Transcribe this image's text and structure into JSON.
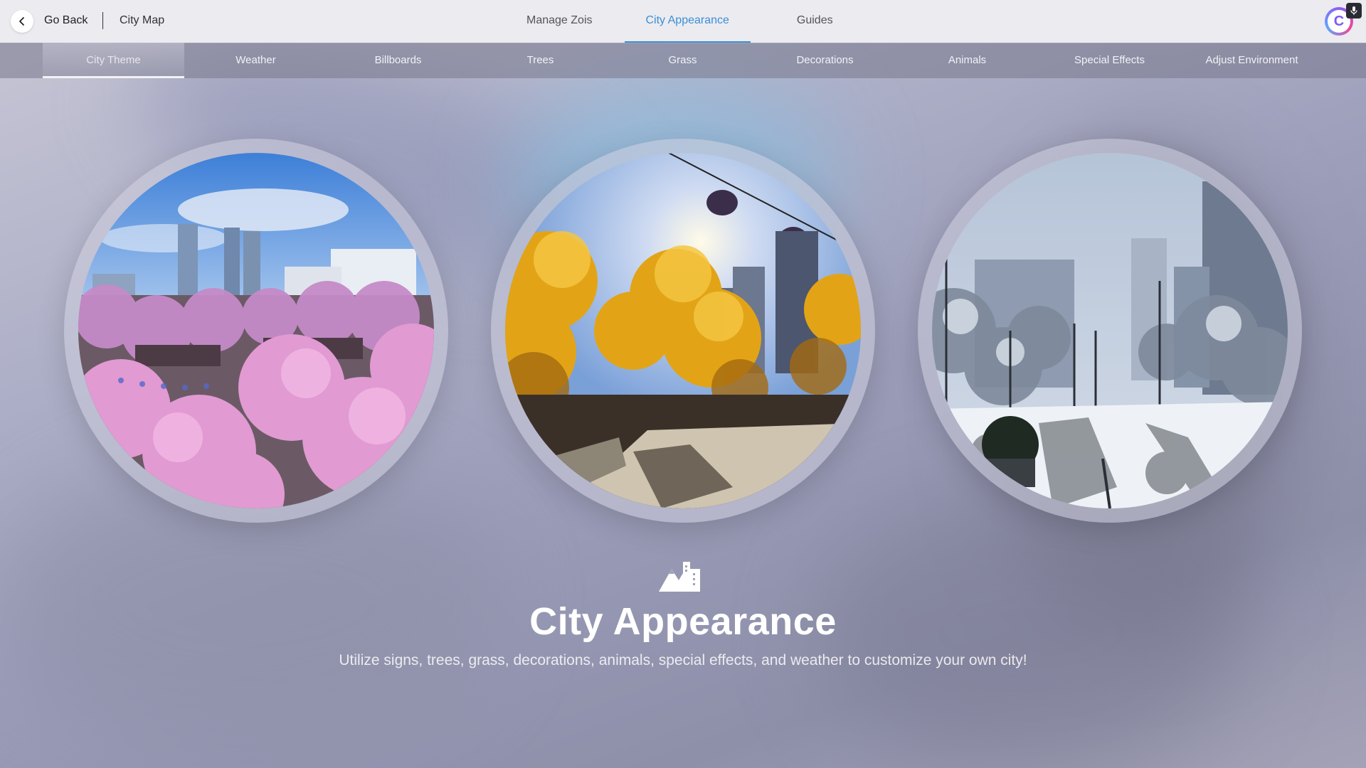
{
  "header": {
    "go_back_label": "Go Back",
    "breadcrumb": "City Map",
    "tabs": [
      {
        "label": "Manage Zois"
      },
      {
        "label": "City Appearance"
      },
      {
        "label": "Guides"
      }
    ],
    "active_tab": "City Appearance",
    "avatar_letter": "C"
  },
  "subnav": {
    "items": [
      {
        "label": "City Theme"
      },
      {
        "label": "Weather"
      },
      {
        "label": "Billboards"
      },
      {
        "label": "Trees"
      },
      {
        "label": "Grass"
      },
      {
        "label": "Decorations"
      },
      {
        "label": "Animals"
      },
      {
        "label": "Special Effects"
      },
      {
        "label": "Adjust Environment"
      }
    ],
    "active_item": "City Theme"
  },
  "themes": [
    {
      "icon": "spring-blossom-city-image"
    },
    {
      "icon": "autumn-city-image"
    },
    {
      "icon": "winter-snow-city-image"
    }
  ],
  "hero": {
    "icon": "city-mountain-icon",
    "title": "City Appearance",
    "description": "Utilize signs, trees, grass, decorations, animals, special effects, and weather to customize your own city!"
  },
  "colors": {
    "accent": "#3b8fd6",
    "topbar_bg": "#ebebf0"
  }
}
